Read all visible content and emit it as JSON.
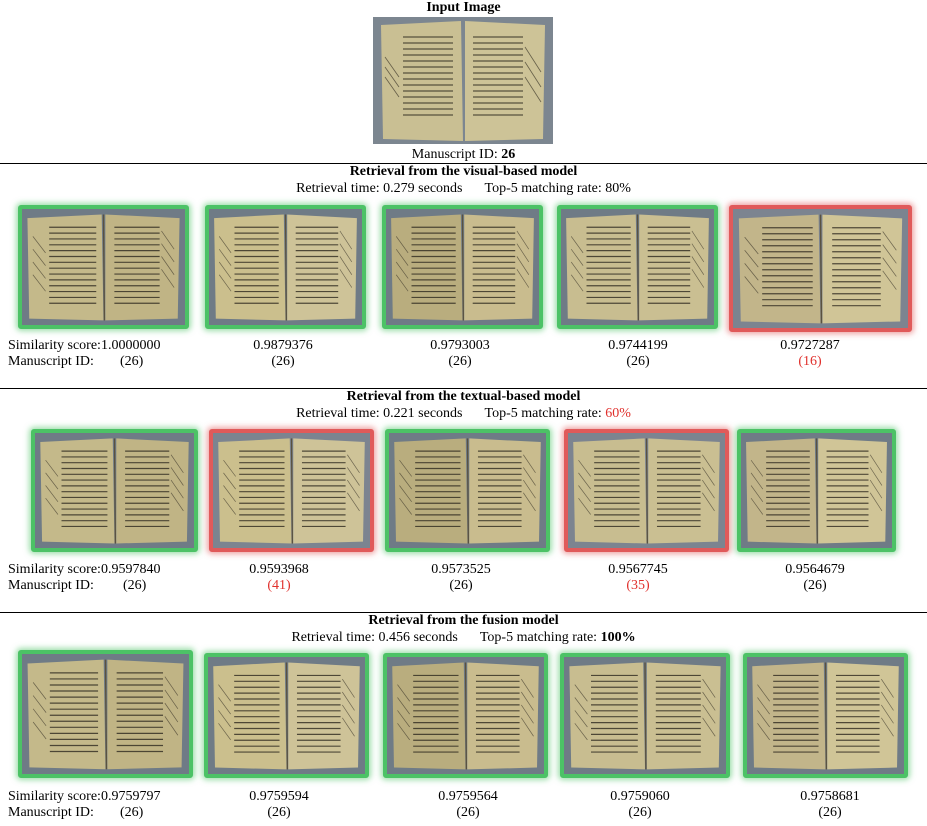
{
  "input": {
    "title": "Input Image",
    "id_label": "Manuscript ID:",
    "id_value": "26"
  },
  "sections": [
    {
      "title": "Retrieval from the visual-based model",
      "time_text": "Retrieval time: 0.279 seconds",
      "rate_label": "Top-5 matching rate:",
      "rate_value": "80%",
      "rate_style": "plain",
      "results": [
        {
          "score": "1.0000000",
          "id": "(26)",
          "match": true
        },
        {
          "score": "0.9879376",
          "id": "(26)",
          "match": true
        },
        {
          "score": "0.9793003",
          "id": "(26)",
          "match": true
        },
        {
          "score": "0.9744199",
          "id": "(26)",
          "match": true
        },
        {
          "score": "0.9727287",
          "id": "(16)",
          "match": false
        }
      ]
    },
    {
      "title": "Retrieval from the textual-based model",
      "time_text": "Retrieval time: 0.221 seconds",
      "rate_label": "Top-5 matching rate:",
      "rate_value": "60%",
      "rate_style": "red",
      "results": [
        {
          "score": "0.9597840",
          "id": "(26)",
          "match": true
        },
        {
          "score": "0.9593968",
          "id": "(41)",
          "match": false
        },
        {
          "score": "0.9573525",
          "id": "(26)",
          "match": true
        },
        {
          "score": "0.9567745",
          "id": "(35)",
          "match": false
        },
        {
          "score": "0.9564679",
          "id": "(26)",
          "match": true
        }
      ]
    },
    {
      "title": "Retrieval from the fusion model",
      "time_text": "Retrieval time: 0.456 seconds",
      "rate_label": "Top-5 matching rate:",
      "rate_value": "100%",
      "rate_style": "bold",
      "results": [
        {
          "score": "0.9759797",
          "id": "(26)",
          "match": true
        },
        {
          "score": "0.9759594",
          "id": "(26)",
          "match": true
        },
        {
          "score": "0.9759564",
          "id": "(26)",
          "match": true
        },
        {
          "score": "0.9759060",
          "id": "(26)",
          "match": true
        },
        {
          "score": "0.9758681",
          "id": "(26)",
          "match": true
        }
      ]
    }
  ],
  "labels": {
    "similarity": "Similarity score:",
    "manuscript_id": "Manuscript ID:"
  },
  "colors": {
    "match_border": "#4cc266",
    "mismatch_border": "#e05a5a",
    "mismatch_text": "#e0302c"
  }
}
